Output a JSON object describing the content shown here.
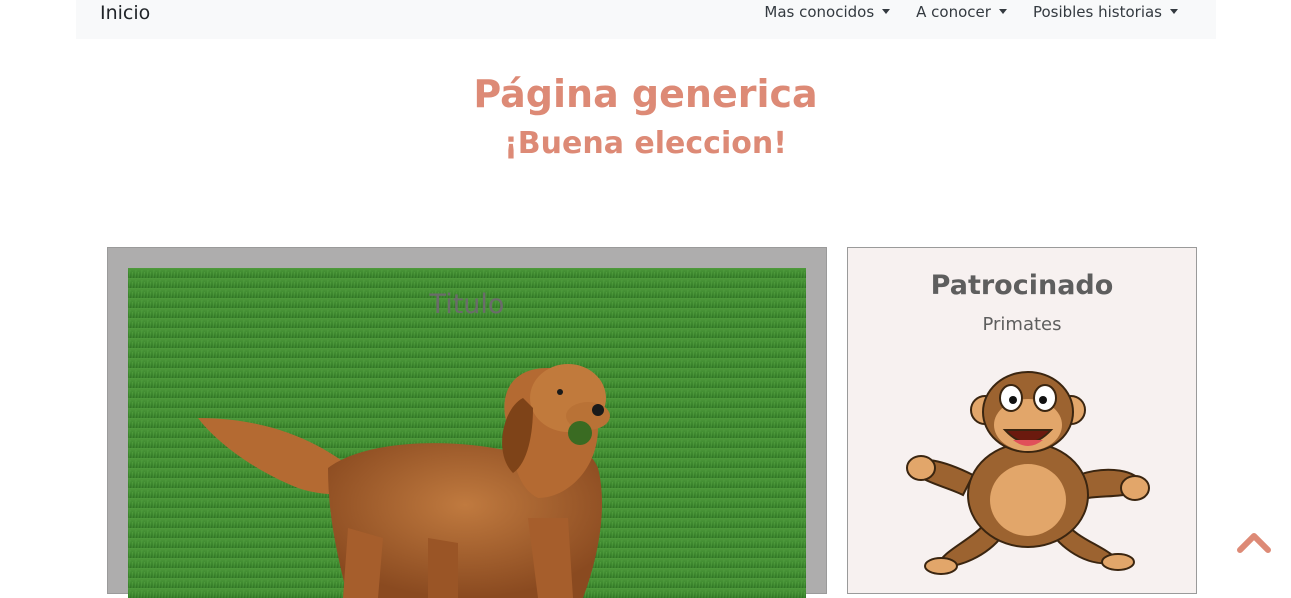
{
  "nav": {
    "brand": "Inicio",
    "items": [
      {
        "label": "Mas conocidos"
      },
      {
        "label": "A conocer"
      },
      {
        "label": "Posibles historias"
      }
    ]
  },
  "header": {
    "title": "Página generica",
    "subtitle": "¡Buena eleccion!"
  },
  "main_card": {
    "title": "Titulo",
    "image": "golden-retriever-dog-photo"
  },
  "sponsor": {
    "title": "Patrocinado",
    "subtitle": "Primates",
    "image": "cartoon-monkey"
  },
  "scroll_top": {
    "icon": "chevron-up-icon"
  },
  "colors": {
    "accent": "#dd8a76",
    "navbar_bg": "#f8f9fa",
    "card_bg": "#aeadad",
    "side_bg": "#f7f1f0"
  }
}
